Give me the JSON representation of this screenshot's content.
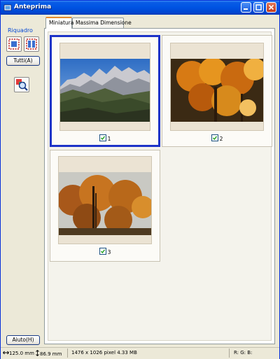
{
  "window": {
    "title": "Anteprima"
  },
  "sidebar": {
    "riquadro_label": "Riquadro",
    "all_button": "Tutti(A)",
    "help_button": "Aiuto(H)"
  },
  "tabs": [
    {
      "label": "Miniatura",
      "active": true
    },
    {
      "label": "Massima Dimensione",
      "active": false
    }
  ],
  "thumbnails": [
    {
      "number": "1",
      "checked": true,
      "selected": true
    },
    {
      "number": "2",
      "checked": true,
      "selected": false
    },
    {
      "number": "3",
      "checked": true,
      "selected": false
    }
  ],
  "statusbar": {
    "width": "125.0 mm",
    "height": "86.9 mm",
    "pixels": "1476 x 1026 pixel 4.33 MB",
    "rgb": "R:  G:  B:"
  },
  "colors": {
    "titlebar": "#0054e3",
    "selection_border": "#1d33c8",
    "tab_accent": "#e68b2c",
    "link_blue": "#0046d5"
  }
}
